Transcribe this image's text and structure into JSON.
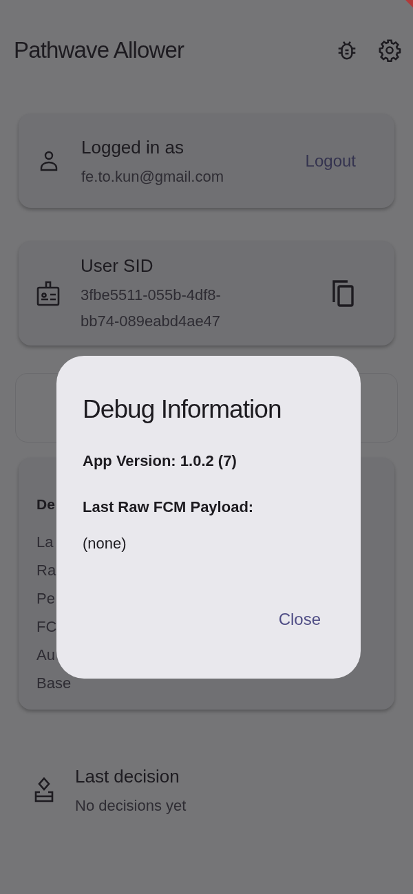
{
  "app_bar": {
    "title": "Pathwave Allower"
  },
  "account_card": {
    "label": "Logged in as",
    "email": "fe.to.kun@gmail.com",
    "action": "Logout"
  },
  "sid_card": {
    "label": "User SID",
    "value": "3fbe5511-055b-4df8-bb74-089eabd4ae47"
  },
  "debug_card": {
    "heading": "De",
    "lines": [
      "La",
      "Ra",
      "Pe",
      "FC",
      "Au",
      "Base"
    ]
  },
  "last_decision": {
    "label": "Last decision",
    "value": "No decisions yet"
  },
  "dialog": {
    "title": "Debug Information",
    "app_version": "App Version: 1.0.2 (7)",
    "payload_label": "Last Raw FCM Payload:",
    "payload": "(none)",
    "action": "Close"
  }
}
